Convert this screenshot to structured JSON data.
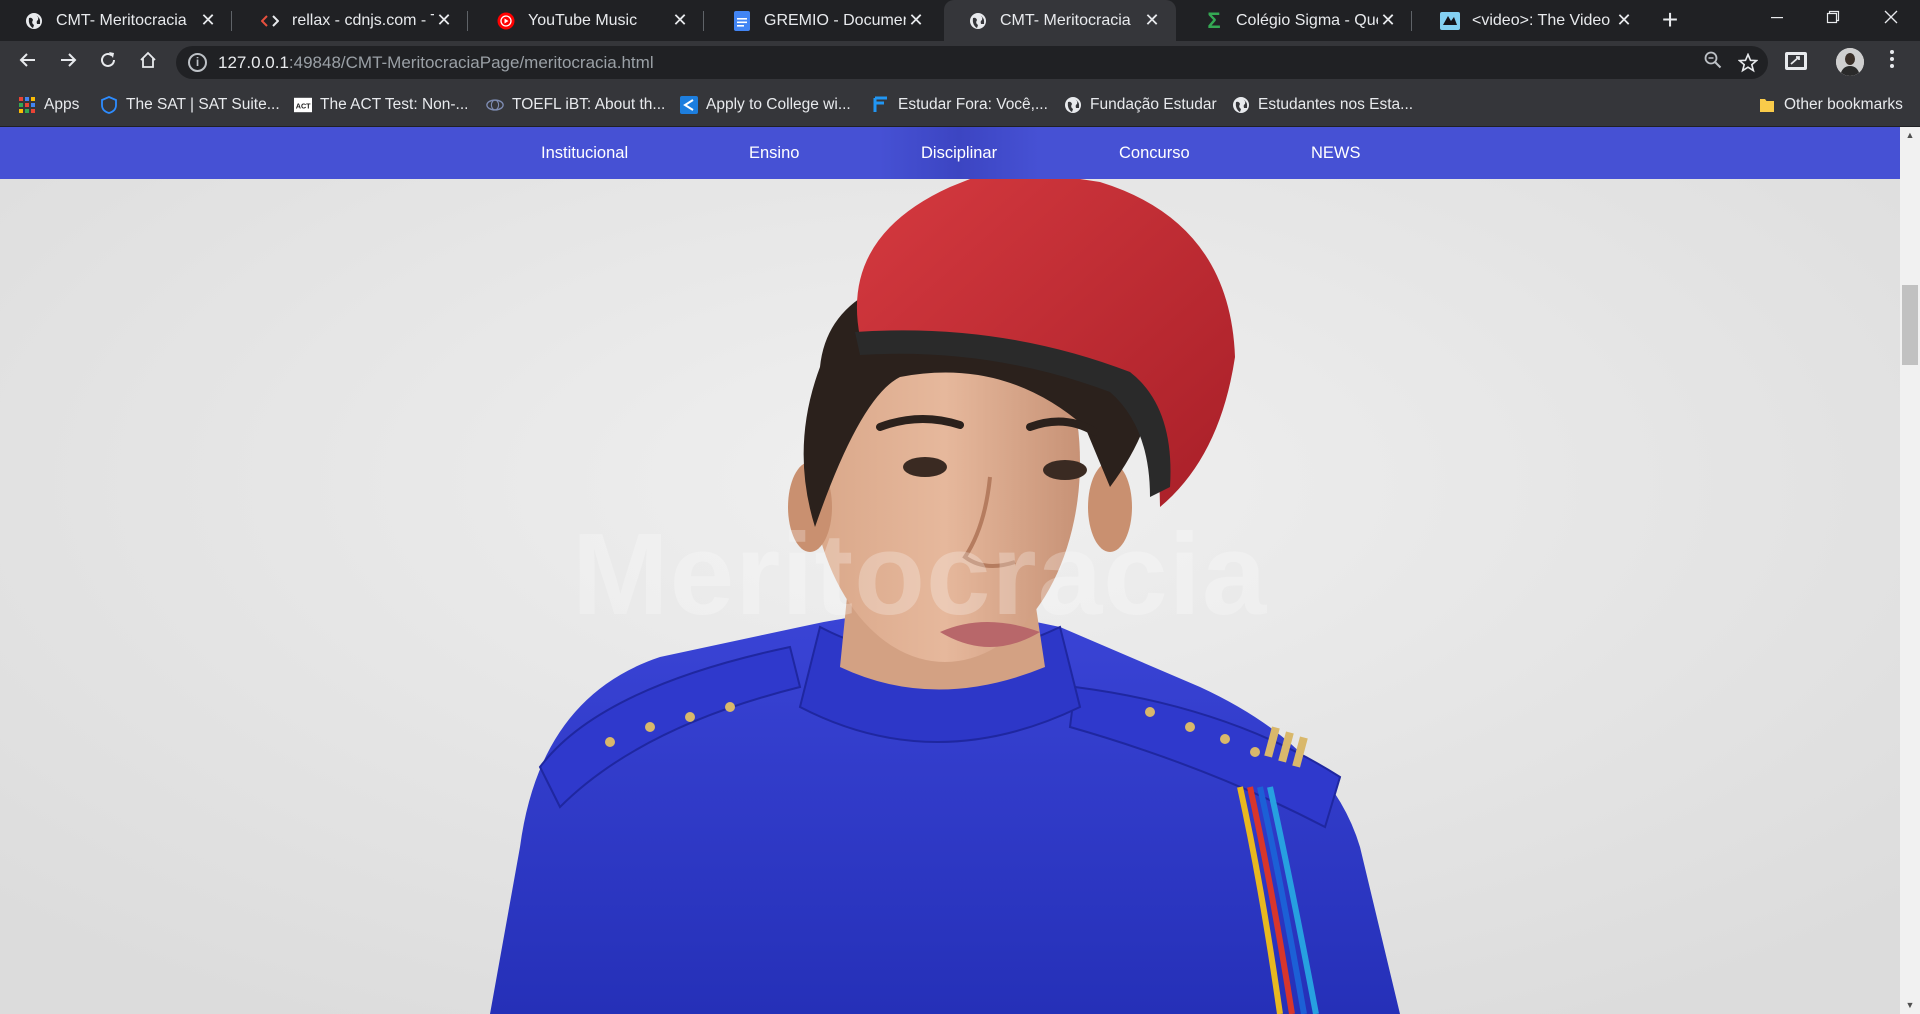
{
  "browser": {
    "tabs": [
      {
        "title": "CMT- Meritocracia",
        "icon": "globe-icon",
        "active": false
      },
      {
        "title": "rellax - cdnjs.com - The",
        "icon": "code-brackets-icon",
        "active": false
      },
      {
        "title": "YouTube Music",
        "icon": "youtube-music-icon",
        "active": false
      },
      {
        "title": "GREMIO - Documentos",
        "icon": "docs-icon",
        "active": false
      },
      {
        "title": "CMT- Meritocracia",
        "icon": "globe-icon",
        "active": true
      },
      {
        "title": "Colégio Sigma - Quem",
        "icon": "sigma-icon",
        "active": false
      },
      {
        "title": "<video>: The Video Em",
        "icon": "mdn-icon",
        "active": false
      }
    ],
    "close_glyph": "✕",
    "new_tab_glyph": "+",
    "url_host": "127.0.0.1",
    "url_path": ":49848/CMT-MeritocraciaPage/meritocracia.html",
    "bookmarks": [
      {
        "label": "Apps",
        "icon": "apps-grid-icon"
      },
      {
        "label": "The SAT | SAT Suite...",
        "icon": "shield-icon"
      },
      {
        "label": "The ACT Test: Non-...",
        "icon": "act-icon"
      },
      {
        "label": "TOEFL iBT: About th...",
        "icon": "toefl-icon"
      },
      {
        "label": "Apply to College wi...",
        "icon": "commonapp-icon"
      },
      {
        "label": "Estudar Fora: Você,...",
        "icon": "estudar-icon"
      },
      {
        "label": "Fundação Estudar",
        "icon": "globe-icon"
      },
      {
        "label": "Estudantes nos Esta...",
        "icon": "globe-icon"
      }
    ],
    "other_bookmarks": "Other bookmarks"
  },
  "site": {
    "nav": [
      "Institucional",
      "Ensino",
      "Disciplinar",
      "Concurso",
      "NEWS"
    ],
    "nav_active": "Disciplinar",
    "hero_watermark": "Meritocracia",
    "nav_color": "#4651d4",
    "beret_color": "#c42a33",
    "uniform_color": "#2c37c4"
  }
}
